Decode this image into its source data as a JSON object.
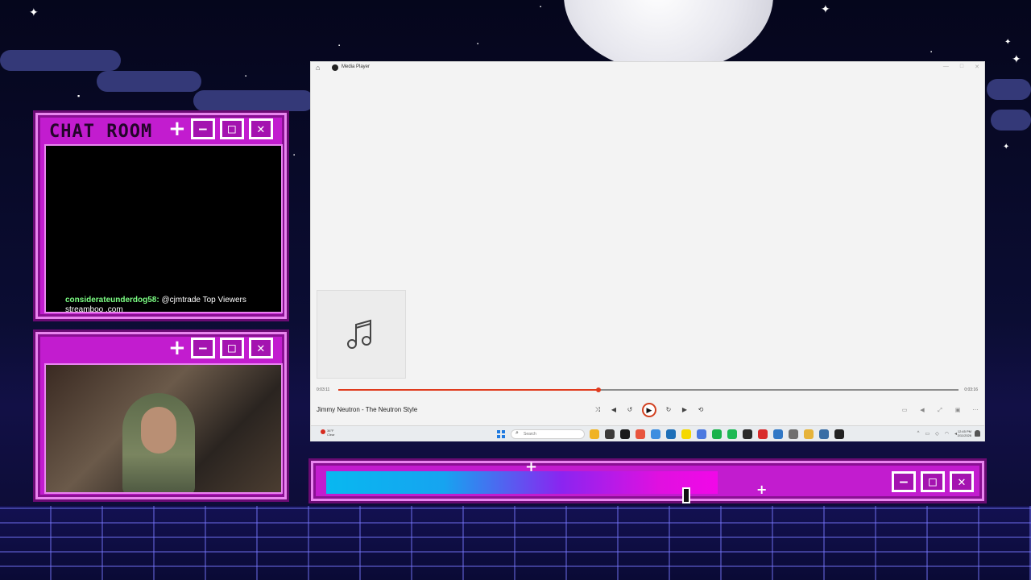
{
  "chat_window": {
    "title": "CHAT ROOM",
    "controls": [
      "+",
      "—",
      "□",
      "✕"
    ],
    "messages": [
      {
        "user": "considerateunderdog58:",
        "text": "@cjmtrade Top Viewers streamboo .com"
      }
    ]
  },
  "cam_window": {
    "controls": [
      "+",
      "—",
      "□",
      "✕"
    ]
  },
  "bottom_bar": {
    "controls": [
      "—",
      "□",
      "✕"
    ]
  },
  "media_player": {
    "title": "Media Player",
    "home_icon": "home-icon",
    "track_title": "Jimmy Neutron - The Neutron Style",
    "elapsed": "0:03:11",
    "remaining": "0:03:16",
    "progress_fraction": 0.42,
    "accent_color": "#e03b1e",
    "controls": [
      {
        "name": "shuffle-icon",
        "glyph": "⤨"
      },
      {
        "name": "previous-icon",
        "glyph": "◀"
      },
      {
        "name": "rewind-icon",
        "glyph": "↺"
      },
      {
        "name": "play-icon",
        "glyph": "▶"
      },
      {
        "name": "forward-icon",
        "glyph": "↻"
      },
      {
        "name": "next-icon",
        "glyph": "▶"
      },
      {
        "name": "repeat-icon",
        "glyph": "⟲"
      }
    ],
    "right_controls": [
      {
        "name": "miniplayer-icon",
        "glyph": "▭"
      },
      {
        "name": "volume-icon",
        "glyph": "◀"
      },
      {
        "name": "fullscreen-icon",
        "glyph": "⤢"
      },
      {
        "name": "cast-icon",
        "glyph": "▣"
      },
      {
        "name": "more-icon",
        "glyph": "⋯"
      }
    ]
  },
  "taskbar": {
    "weather_temp": "36°F",
    "weather_text": "Clear",
    "search_placeholder": "Search",
    "search_icon": "search-icon",
    "apps": [
      "#f0b323",
      "#3a3a3a",
      "#1b1b1b",
      "#e8553f",
      "#3d8ee0",
      "#1d6fb8",
      "#f5d800",
      "#4a78e0",
      "#1ab24c",
      "#1db954",
      "#2a2a2a",
      "#d92b2b",
      "#3178c6",
      "#6f6f6f",
      "#e6b33a",
      "#3a6ea5",
      "#222222"
    ],
    "time": "12:45 PM",
    "date": "3/11/2026"
  }
}
